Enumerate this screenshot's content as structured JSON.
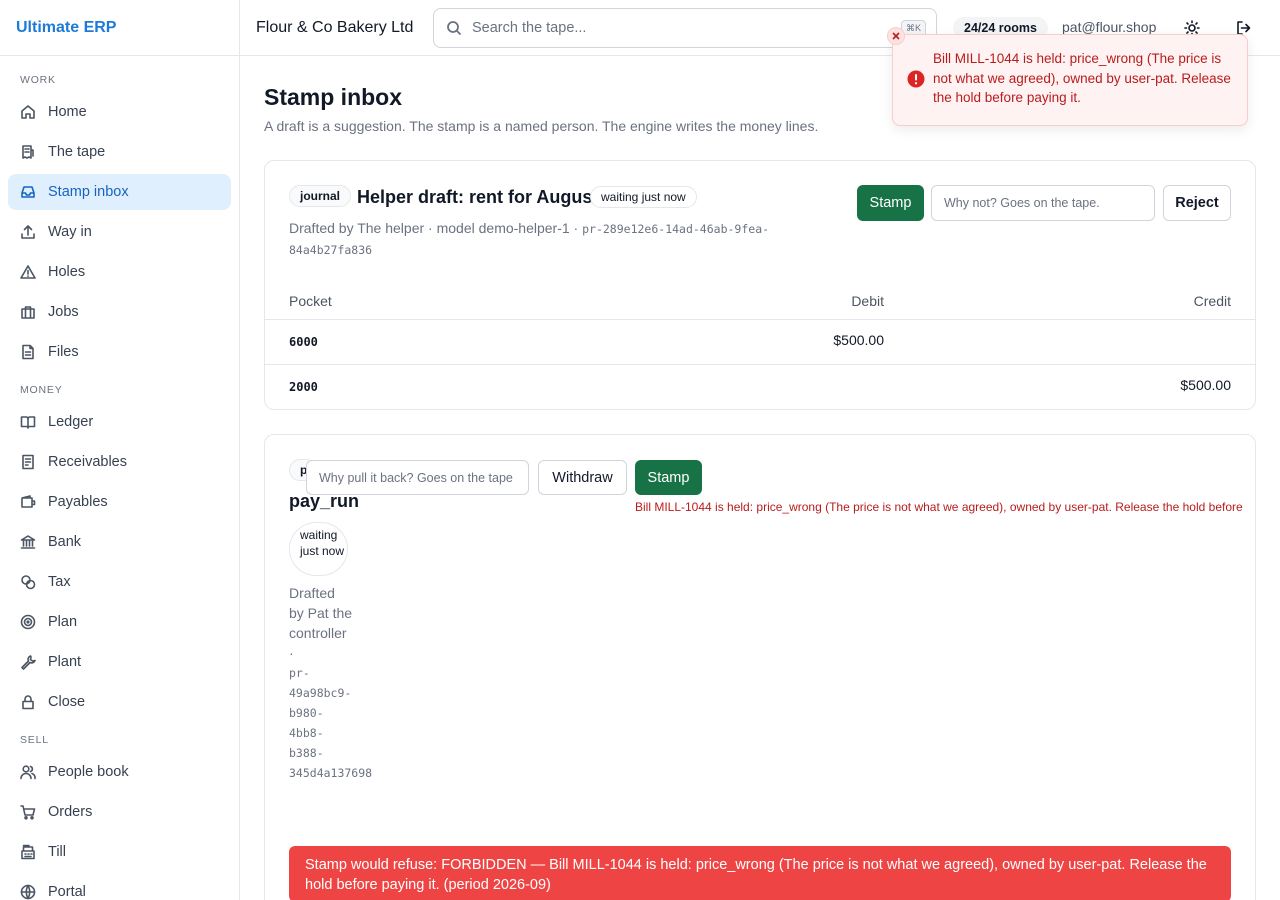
{
  "brand": "Ultimate ERP",
  "sidebar": {
    "sections": [
      {
        "label": "WORK",
        "items": [
          {
            "label": "Home",
            "icon": "home-icon"
          },
          {
            "label": "The tape",
            "icon": "receipt-icon"
          },
          {
            "label": "Stamp inbox",
            "icon": "inbox-icon",
            "active": true
          },
          {
            "label": "Way in",
            "icon": "upload-icon"
          },
          {
            "label": "Holes",
            "icon": "warning-triangle-icon"
          },
          {
            "label": "Jobs",
            "icon": "briefcase-icon"
          },
          {
            "label": "Files",
            "icon": "file-icon"
          }
        ]
      },
      {
        "label": "MONEY",
        "items": [
          {
            "label": "Ledger",
            "icon": "book-icon"
          },
          {
            "label": "Receivables",
            "icon": "receivable-icon"
          },
          {
            "label": "Payables",
            "icon": "wallet-icon"
          },
          {
            "label": "Bank",
            "icon": "bank-icon"
          },
          {
            "label": "Tax",
            "icon": "coins-icon"
          },
          {
            "label": "Plan",
            "icon": "target-icon"
          },
          {
            "label": "Plant",
            "icon": "wrench-icon"
          },
          {
            "label": "Close",
            "icon": "lock-icon"
          }
        ]
      },
      {
        "label": "SELL",
        "items": [
          {
            "label": "People book",
            "icon": "users-icon"
          },
          {
            "label": "Orders",
            "icon": "cart-icon"
          },
          {
            "label": "Till",
            "icon": "register-icon"
          },
          {
            "label": "Portal",
            "icon": "globe-icon"
          }
        ]
      }
    ]
  },
  "topbar": {
    "company": "Flour & Co Bakery Ltd",
    "search_placeholder": "Search the tape...",
    "search_shortcut": "⌘K",
    "rooms": "24/24 rooms",
    "user": "pat@flour.shop"
  },
  "page": {
    "title": "Stamp inbox",
    "subtitle": "A draft is a suggestion. The stamp is a named person. The engine writes the money lines."
  },
  "card1": {
    "kind": "journal",
    "title": "Helper draft: rent for August",
    "status": "waiting just now",
    "meta": "Drafted by The helper · model demo-helper-1 ·",
    "id": "pr-289e12e6-14ad-46ab-9fea-84a4b27fa836",
    "stamp_label": "Stamp",
    "reason_placeholder": "Why not? Goes on the tape.",
    "reject_label": "Reject",
    "columns": [
      "Pocket",
      "Debit",
      "Credit"
    ],
    "rows": [
      {
        "pocket": "6000",
        "debit": "$500.00",
        "credit": ""
      },
      {
        "pocket": "2000",
        "debit": "",
        "credit": "$500.00"
      }
    ]
  },
  "card2": {
    "kind": "pay_run",
    "kind_visible": "p",
    "title": "pay_run",
    "status": "waiting just now",
    "meta": "Drafted by Pat the controller ·",
    "id": "pr-49a98bc9-b980-4bb8-b388-345d4a137698",
    "reason_placeholder": "Why pull it back? Goes on the tape",
    "withdraw_label": "Withdraw",
    "stamp_label": "Stamp",
    "inline_error": "Bill MILL-1044 is held: price_wrong (The price is not what we agreed), owned by user-pat. Release the hold before",
    "alert": "Stamp would refuse: FORBIDDEN — Bill MILL-1044 is held: price_wrong (The price is not what we agreed), owned by user-pat. Release the hold before paying it. (period 2026-09)"
  },
  "toast": {
    "message": "Bill MILL-1044 is held: price_wrong (The price is not what we agreed), owned by user-pat. Release the hold before paying it."
  },
  "colors": {
    "accent": "#1d7bd8",
    "stamp": "#177245",
    "danger": "#ef4444",
    "error_text": "#b91c1c"
  }
}
